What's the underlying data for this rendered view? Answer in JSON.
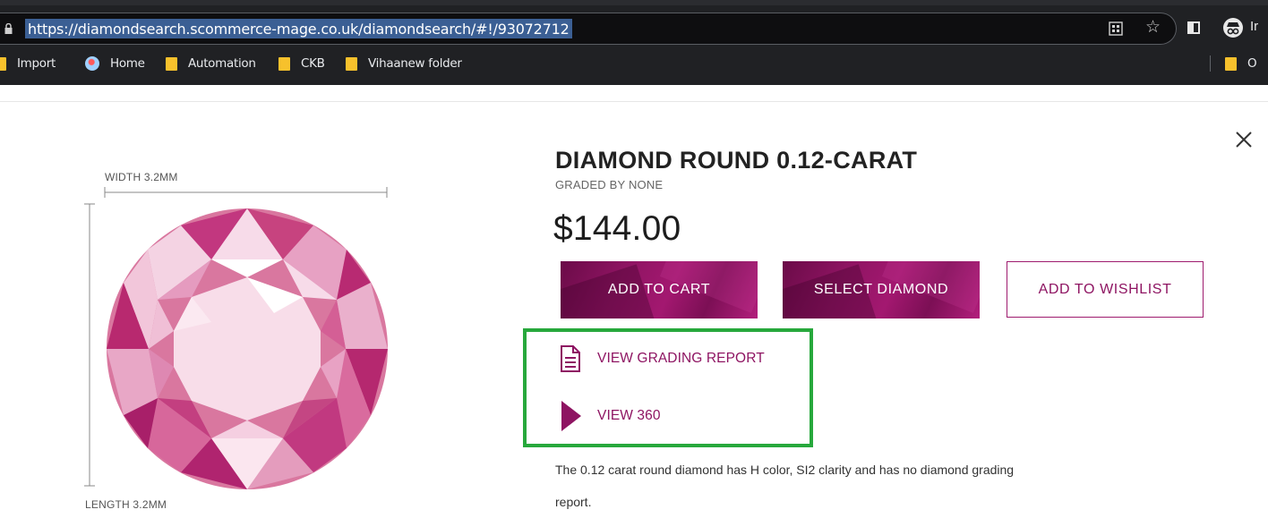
{
  "browser": {
    "url": "https://diamondsearch.scommerce-mage.co.uk/diamondsearch/#!/93072712",
    "profile_label": "Ir",
    "bookmarks": [
      {
        "label": "Import",
        "icon": "folder-icon"
      },
      {
        "label": "Home",
        "icon": "home-icon"
      },
      {
        "label": "Automation",
        "icon": "folder-icon"
      },
      {
        "label": "CKB",
        "icon": "folder-icon"
      },
      {
        "label": "Vihaanew folder",
        "icon": "folder-icon"
      }
    ],
    "other_bookmarks_label": "O"
  },
  "product": {
    "width_label": "WIDTH 3.2MM",
    "length_label": "LENGTH 3.2MM",
    "title": "DIAMOND ROUND 0.12-CARAT",
    "subtitle": "GRADED BY NONE",
    "price": "$144.00",
    "buttons": {
      "add_to_cart": "ADD TO CART",
      "select_diamond": "SELECT DIAMOND",
      "add_to_wishlist": "ADD TO WISHLIST"
    },
    "links": {
      "grading_report": "VIEW GRADING REPORT",
      "view_360": "VIEW 360"
    },
    "description": "The 0.12 carat round diamond has H color, SI2 clarity and has no diamond grading report."
  },
  "colors": {
    "brand": "#8e1462",
    "highlight": "#27a83c",
    "diamond_dark": "#b0246f",
    "diamond_light": "#f7dbe9"
  }
}
